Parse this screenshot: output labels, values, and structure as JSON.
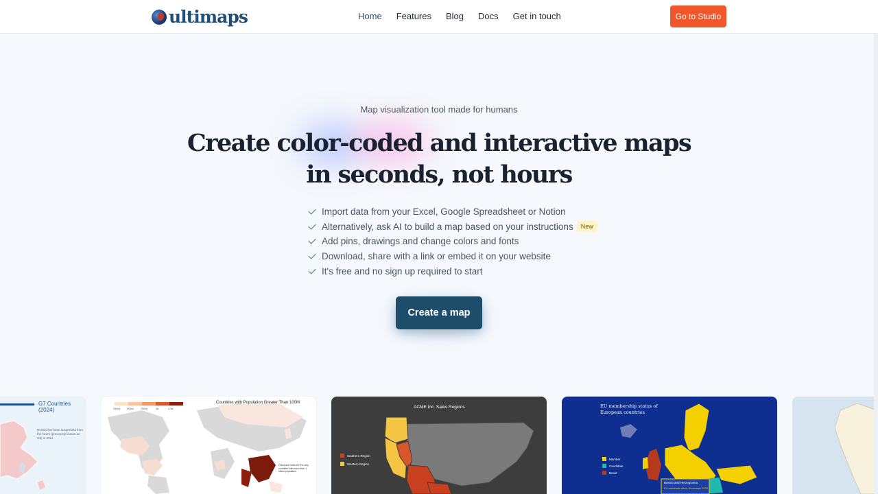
{
  "nav": {
    "logo_text": "ultimaps",
    "links": [
      "Home",
      "Features",
      "Blog",
      "Docs",
      "Get in touch"
    ],
    "studio_button": "Go to Studio"
  },
  "hero": {
    "tagline": "Map visualization tool made for humans",
    "title_line1": "Create color-coded and interactive maps",
    "title_line2": "in seconds, not hours",
    "features": [
      "Import data from your Excel, Google Spreadsheet or Notion",
      "Alternatively, ask AI to build a map based on your instructions",
      "Add pins, drawings and change colors and fonts",
      "Download, share with a link or embed it on your website",
      "It's free and no sign up required to start"
    ],
    "new_badge": "New",
    "cta": "Create a map"
  },
  "gallery": {
    "g7": {
      "title": "G7 Countries (2024)",
      "note": "Russia has been suspended from the forum (previously known as G8) in 2014"
    },
    "population": {
      "title": "Countries with Population Greater Than 100M",
      "legend": [
        "250m",
        "500m",
        "750m",
        "1b",
        "1.5b"
      ],
      "note": "China and India are the only countries with more than 1 billion population"
    },
    "acme": {
      "title": "ACME Inc. Sales Regions",
      "legend": [
        "Southern Region",
        "Western Region"
      ]
    },
    "eu": {
      "title_line1": "EU membership status of",
      "title_line2": "European countries",
      "legend": [
        "Member",
        "Candidate",
        "Brexit"
      ],
      "callout_title": "Bosnia and Herzegovina",
      "callout_text": "EU candidate since December 2022"
    }
  },
  "colors": {
    "accent": "#f1572c",
    "primary": "#1e4d6b",
    "check": "#3b7a57"
  }
}
